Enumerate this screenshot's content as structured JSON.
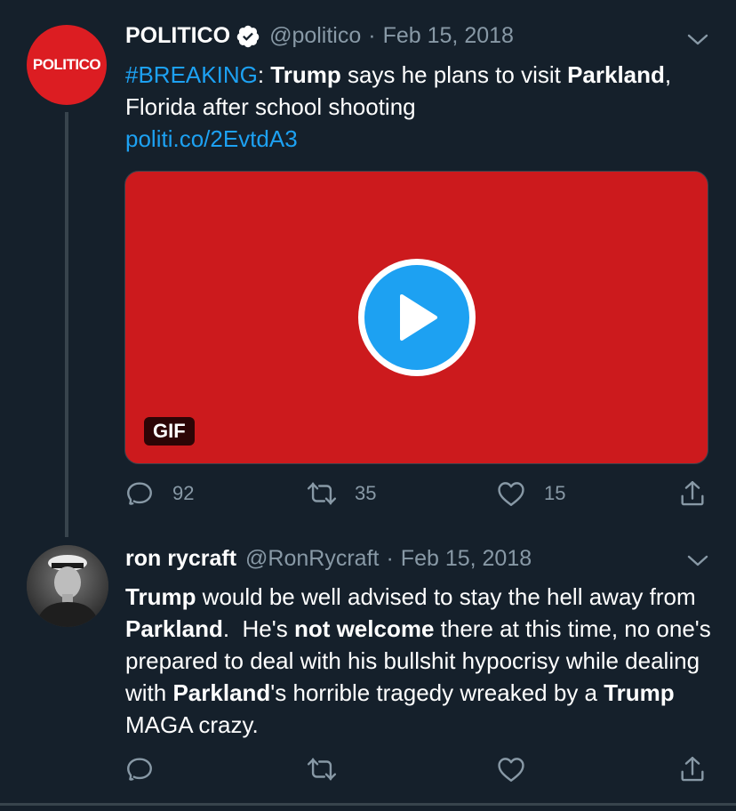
{
  "tweet1": {
    "avatar_text": "POLITICO",
    "name": "POLITICO",
    "handle": "@politico",
    "sep": "·",
    "date": "Feb 15, 2018",
    "text": {
      "hashtag": "#BREAKING",
      "p1": ": ",
      "b1": "Trump",
      "p2": " says he plans to visit ",
      "b2": "Parkland",
      "p3": ", Florida after school shooting",
      "link": "politi.co/2EvtdA3"
    },
    "media": {
      "badge": "GIF",
      "background_color": "#cc1a1d"
    },
    "actions": {
      "replies": "92",
      "retweets": "35",
      "likes": "15"
    }
  },
  "tweet2": {
    "name": "ron rycraft",
    "handle": "@RonRycraft",
    "sep": "·",
    "date": "Feb 15, 2018",
    "text": {
      "b1": "Trump",
      "p1": " would be well advised to stay the hell away from ",
      "b2": "Parkland",
      "p2": ".  He's ",
      "b3": "not welcome",
      "p3": " there at this time, no one's prepared to deal with his bullshit hypocrisy while dealing with ",
      "b4": "Parkland",
      "p4": "'s horrible tragedy wreaked by a ",
      "b5": "Trump",
      "p5": " MAGA crazy."
    }
  },
  "colors": {
    "background": "#15202b",
    "accent": "#1da1f2",
    "secondary_text": "#8899a6",
    "politico_red": "#dc1d22"
  },
  "icons": [
    "verified-badge-icon",
    "chevron-down-icon",
    "reply-icon",
    "retweet-icon",
    "like-icon",
    "share-icon",
    "play-icon"
  ]
}
